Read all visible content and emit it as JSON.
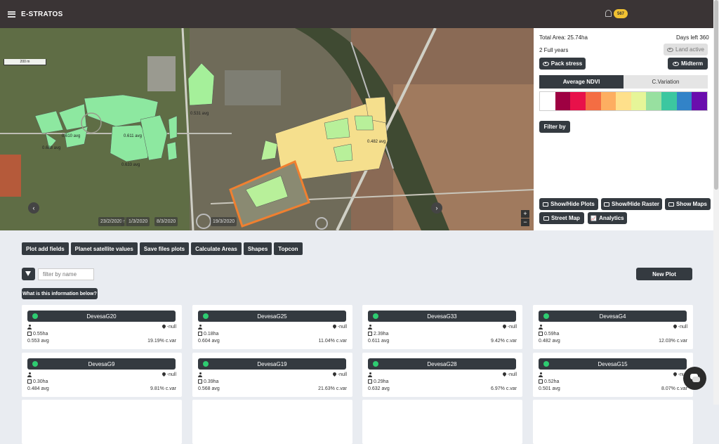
{
  "header": {
    "brand": "E-STRATOS",
    "notification_count": "567"
  },
  "map": {
    "scale_label": "200 m",
    "plot_labels": [
      "0.531 avg",
      "0.610 avg",
      "0.611 avg",
      "0.688 avg",
      "0.633 avg",
      "0.482 avg"
    ],
    "dates": [
      "23/2/2020",
      "1/3/2020",
      "8/3/2020",
      "19/3/2020"
    ],
    "zoom_in": "+",
    "zoom_out": "−"
  },
  "panel": {
    "total_area": "Total Area: 25.74ha",
    "days_left": "Days left 360",
    "full_years": "2 Full years",
    "land_active": "Land active",
    "pack_stress": "Pack stress",
    "midterm": "Midterm",
    "tabs": [
      "Average NDVI",
      "C.Variation"
    ],
    "color_scale": [
      "#ffffff",
      "#9e0142",
      "#e8114a",
      "#f46d43",
      "#fdae61",
      "#fee08b",
      "#e6f598",
      "#98e0a0",
      "#3cc7a0",
      "#3283c8",
      "#6a0dad"
    ],
    "filter_by": "Filter by",
    "view_buttons": [
      "Show/Hide Plots",
      "Show/Hide Raster",
      "Show Maps",
      "Street Map",
      "Analytics"
    ]
  },
  "actions": [
    "Plot add fields",
    "Planet satellite values",
    "Save files plots",
    "Calculate Areas",
    "Shapes",
    "Topcon"
  ],
  "filter": {
    "placeholder": "filter by name"
  },
  "new_plot": "New Plot",
  "info_button": "What is this information below?",
  "cards": [
    {
      "name": "DevesaG20",
      "location": "-null",
      "area": "0.55ha",
      "avg": "0.553 avg",
      "cvar": "19.19% c.var"
    },
    {
      "name": "DevesaG25",
      "location": "-null",
      "area": "0.18ha",
      "avg": "0.604 avg",
      "cvar": "11.04% c.var"
    },
    {
      "name": "DevesaG33",
      "location": "-null",
      "area": "2.39ha",
      "avg": "0.611 avg",
      "cvar": "9.42% c.var"
    },
    {
      "name": "DevesaG4",
      "location": "-null",
      "area": "0.59ha",
      "avg": "0.482 avg",
      "cvar": "12.03% c.var"
    },
    {
      "name": "DevesaG9",
      "location": "-null",
      "area": "0.30ha",
      "avg": "0.484 avg",
      "cvar": "9.81% c.var"
    },
    {
      "name": "DevesaG19",
      "location": "-null",
      "area": "0.39ha",
      "avg": "0.568 avg",
      "cvar": "21.63% c.var"
    },
    {
      "name": "DevesaG28",
      "location": "-null",
      "area": "0.29ha",
      "avg": "0.632 avg",
      "cvar": "6.97% c.var"
    },
    {
      "name": "DevesaG15",
      "location": "-null",
      "area": "0.52ha",
      "avg": "0.501 avg",
      "cvar": "8.07% c.var"
    }
  ]
}
